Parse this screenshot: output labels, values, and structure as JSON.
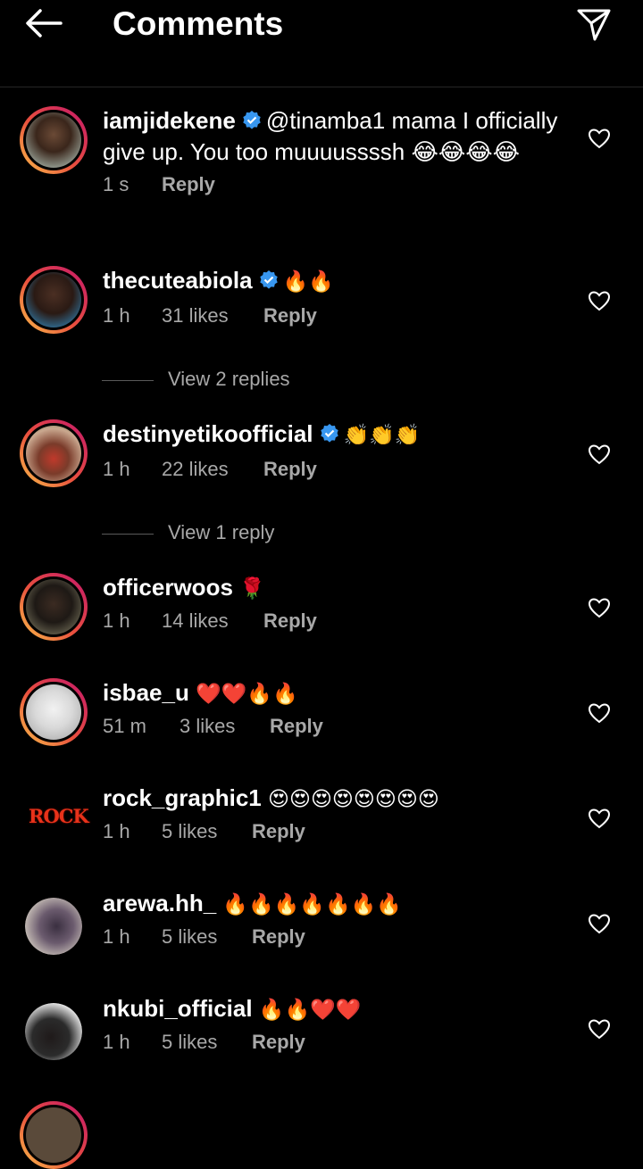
{
  "header": {
    "title": "Comments",
    "back_icon": "arrow-left-icon",
    "send_icon": "paper-plane-icon"
  },
  "comments": [
    {
      "username": "iamjidekene",
      "verified": true,
      "mention": "@tinamba1",
      "text": " mama I officially give up. You too muuuussssh 😂😂😂😂",
      "time": "1 s",
      "likes": "",
      "reply_label": "Reply"
    },
    {
      "username": "thecuteabiola",
      "verified": true,
      "text": "🔥🔥",
      "time": "1 h",
      "likes": "31 likes",
      "reply_label": "Reply",
      "view_replies": "View 2 replies"
    },
    {
      "username": "destinyetikoofficial",
      "verified": true,
      "text": "👏👏👏",
      "time": "1 h",
      "likes": "22 likes",
      "reply_label": "Reply",
      "view_replies": "View 1 reply"
    },
    {
      "username": "officerwoos",
      "verified": false,
      "text": "🌹",
      "time": "1 h",
      "likes": "14 likes",
      "reply_label": "Reply"
    },
    {
      "username": "isbae_u",
      "verified": false,
      "text": "❤️❤️🔥🔥",
      "time": "51 m",
      "likes": "3 likes",
      "reply_label": "Reply"
    },
    {
      "username": "rock_graphic1",
      "verified": false,
      "text": "😍😍😍😍😍😍😍😍",
      "time": "1 h",
      "likes": "5 likes",
      "reply_label": "Reply",
      "avatar_text": "ROCK"
    },
    {
      "username": "arewa.hh_",
      "verified": false,
      "text": "🔥🔥🔥🔥🔥🔥🔥",
      "time": "1 h",
      "likes": "5 likes",
      "reply_label": "Reply"
    },
    {
      "username": "nkubi_official",
      "verified": false,
      "text": "🔥🔥❤️❤️",
      "time": "1 h",
      "likes": "5 likes",
      "reply_label": "Reply"
    }
  ],
  "colors": {
    "background": "#000000",
    "text": "#ffffff",
    "secondary_text": "#a8a8a8",
    "verified_badge": "#3897f0",
    "divider": "#262626"
  }
}
